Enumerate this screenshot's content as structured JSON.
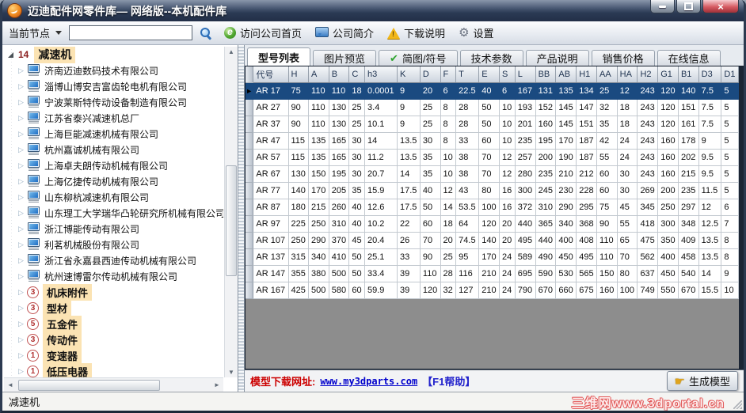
{
  "window": {
    "title": "迈迪配件网零件库— 网络版--本机配件库"
  },
  "toolbar": {
    "node_label": "当前节点",
    "search_value": "",
    "visit_homepage": "访问公司首页",
    "company_intro": "公司简介",
    "download_note": "下载说明",
    "settings": "设置"
  },
  "tree": {
    "root": {
      "count": "14",
      "label": "减速机"
    },
    "companies": [
      "济南迈迪数码技术有限公司",
      "淄博山博安吉富齿轮电机有限公司",
      "宁波莱斯特传动设备制造有限公司",
      "江苏省泰兴减速机总厂",
      "上海巨能减速机械有限公司",
      "杭州嘉诚机械有限公司",
      "上海卓夫朗传动机械有限公司",
      "上海亿捷传动机械有限公司",
      "山东柳杭减速机有限公司",
      "山东理工大学瑞华凸轮研究所机械有限公司",
      "浙江博能传动有限公司",
      "利茗机械股份有限公司",
      "浙江省永嘉县西迪传动机械有限公司",
      "杭州速博雷尔传动机械有限公司"
    ],
    "categories": [
      {
        "count": "3",
        "label": "机床附件"
      },
      {
        "count": "3",
        "label": "型材"
      },
      {
        "count": "5",
        "label": "五金件"
      },
      {
        "count": "3",
        "label": "传动件"
      },
      {
        "count": "1",
        "label": "变速器"
      },
      {
        "count": "1",
        "label": "低压电器"
      }
    ]
  },
  "tabs": {
    "active": "型号列表",
    "check_icon_tab": "简图/符号",
    "items": [
      "型号列表",
      "图片预览",
      "简图/符号",
      "技术参数",
      "产品说明",
      "销售价格",
      "在线信息"
    ]
  },
  "table": {
    "columns": [
      "代号",
      "H",
      "A",
      "B",
      "C",
      "h3",
      "K",
      "D",
      "F",
      "T",
      "E",
      "S",
      "L",
      "BB",
      "AB",
      "H1",
      "AA",
      "HA",
      "H2",
      "G1",
      "B1",
      "D3",
      "D1"
    ],
    "selected_index": 0,
    "selected_marker": "►",
    "rows": [
      [
        "AR 17",
        "75",
        "110",
        "110",
        "18",
        "0.0001",
        "9",
        "20",
        "6",
        "22.5",
        "40",
        "6",
        "167",
        "131",
        "135",
        "134",
        "25",
        "12",
        "243",
        "120",
        "140",
        "7.5",
        "5"
      ],
      [
        "AR 27",
        "90",
        "110",
        "130",
        "25",
        "3.4",
        "9",
        "25",
        "8",
        "28",
        "50",
        "10",
        "193",
        "152",
        "145",
        "147",
        "32",
        "18",
        "243",
        "120",
        "151",
        "7.5",
        "5"
      ],
      [
        "AR 37",
        "90",
        "110",
        "130",
        "25",
        "10.1",
        "9",
        "25",
        "8",
        "28",
        "50",
        "10",
        "201",
        "160",
        "145",
        "151",
        "35",
        "18",
        "243",
        "120",
        "161",
        "7.5",
        "5"
      ],
      [
        "AR 47",
        "115",
        "135",
        "165",
        "30",
        "14",
        "13.5",
        "30",
        "8",
        "33",
        "60",
        "10",
        "235",
        "195",
        "170",
        "187",
        "42",
        "24",
        "243",
        "160",
        "178",
        "9",
        "5"
      ],
      [
        "AR 57",
        "115",
        "135",
        "165",
        "30",
        "11.2",
        "13.5",
        "35",
        "10",
        "38",
        "70",
        "12",
        "257",
        "200",
        "190",
        "187",
        "55",
        "24",
        "243",
        "160",
        "202",
        "9.5",
        "5"
      ],
      [
        "AR 67",
        "130",
        "150",
        "195",
        "30",
        "20.7",
        "14",
        "35",
        "10",
        "38",
        "70",
        "12",
        "280",
        "235",
        "210",
        "212",
        "60",
        "30",
        "243",
        "160",
        "215",
        "9.5",
        "5"
      ],
      [
        "AR 77",
        "140",
        "170",
        "205",
        "35",
        "15.9",
        "17.5",
        "40",
        "12",
        "43",
        "80",
        "16",
        "300",
        "245",
        "230",
        "228",
        "60",
        "30",
        "269",
        "200",
        "235",
        "11.5",
        "5"
      ],
      [
        "AR 87",
        "180",
        "215",
        "260",
        "40",
        "12.6",
        "17.5",
        "50",
        "14",
        "53.5",
        "100",
        "16",
        "372",
        "310",
        "290",
        "295",
        "75",
        "45",
        "345",
        "250",
        "297",
        "12",
        "6"
      ],
      [
        "AR 97",
        "225",
        "250",
        "310",
        "40",
        "10.2",
        "22",
        "60",
        "18",
        "64",
        "120",
        "20",
        "440",
        "365",
        "340",
        "368",
        "90",
        "55",
        "418",
        "300",
        "348",
        "12.5",
        "7"
      ],
      [
        "AR 107",
        "250",
        "290",
        "370",
        "45",
        "20.4",
        "26",
        "70",
        "20",
        "74.5",
        "140",
        "20",
        "495",
        "440",
        "400",
        "408",
        "110",
        "65",
        "475",
        "350",
        "409",
        "13.5",
        "8"
      ],
      [
        "AR 137",
        "315",
        "340",
        "410",
        "50",
        "25.1",
        "33",
        "90",
        "25",
        "95",
        "170",
        "24",
        "589",
        "490",
        "450",
        "495",
        "110",
        "70",
        "562",
        "400",
        "458",
        "13.5",
        "8"
      ],
      [
        "AR 147",
        "355",
        "380",
        "500",
        "50",
        "33.4",
        "39",
        "110",
        "28",
        "116",
        "210",
        "24",
        "695",
        "590",
        "530",
        "565",
        "150",
        "80",
        "637",
        "450",
        "540",
        "14",
        "9"
      ],
      [
        "AR 167",
        "425",
        "500",
        "580",
        "60",
        "59.9",
        "39",
        "120",
        "32",
        "127",
        "210",
        "24",
        "790",
        "670",
        "660",
        "675",
        "160",
        "100",
        "749",
        "550",
        "670",
        "15.5",
        "10"
      ]
    ]
  },
  "footer": {
    "label": "模型下载网址:",
    "link": "www.my3dparts.com",
    "help": "【F1帮助】",
    "generate_button": "生成模型"
  },
  "statusbar": {
    "text": "减速机"
  },
  "watermark": "三维网www.3dportal.cn",
  "colors": {
    "selected_row": "#1a4a80",
    "accent_red": "#cc0000",
    "tree_highlight": "#fbe3b3",
    "link_blue": "#0000cc"
  }
}
